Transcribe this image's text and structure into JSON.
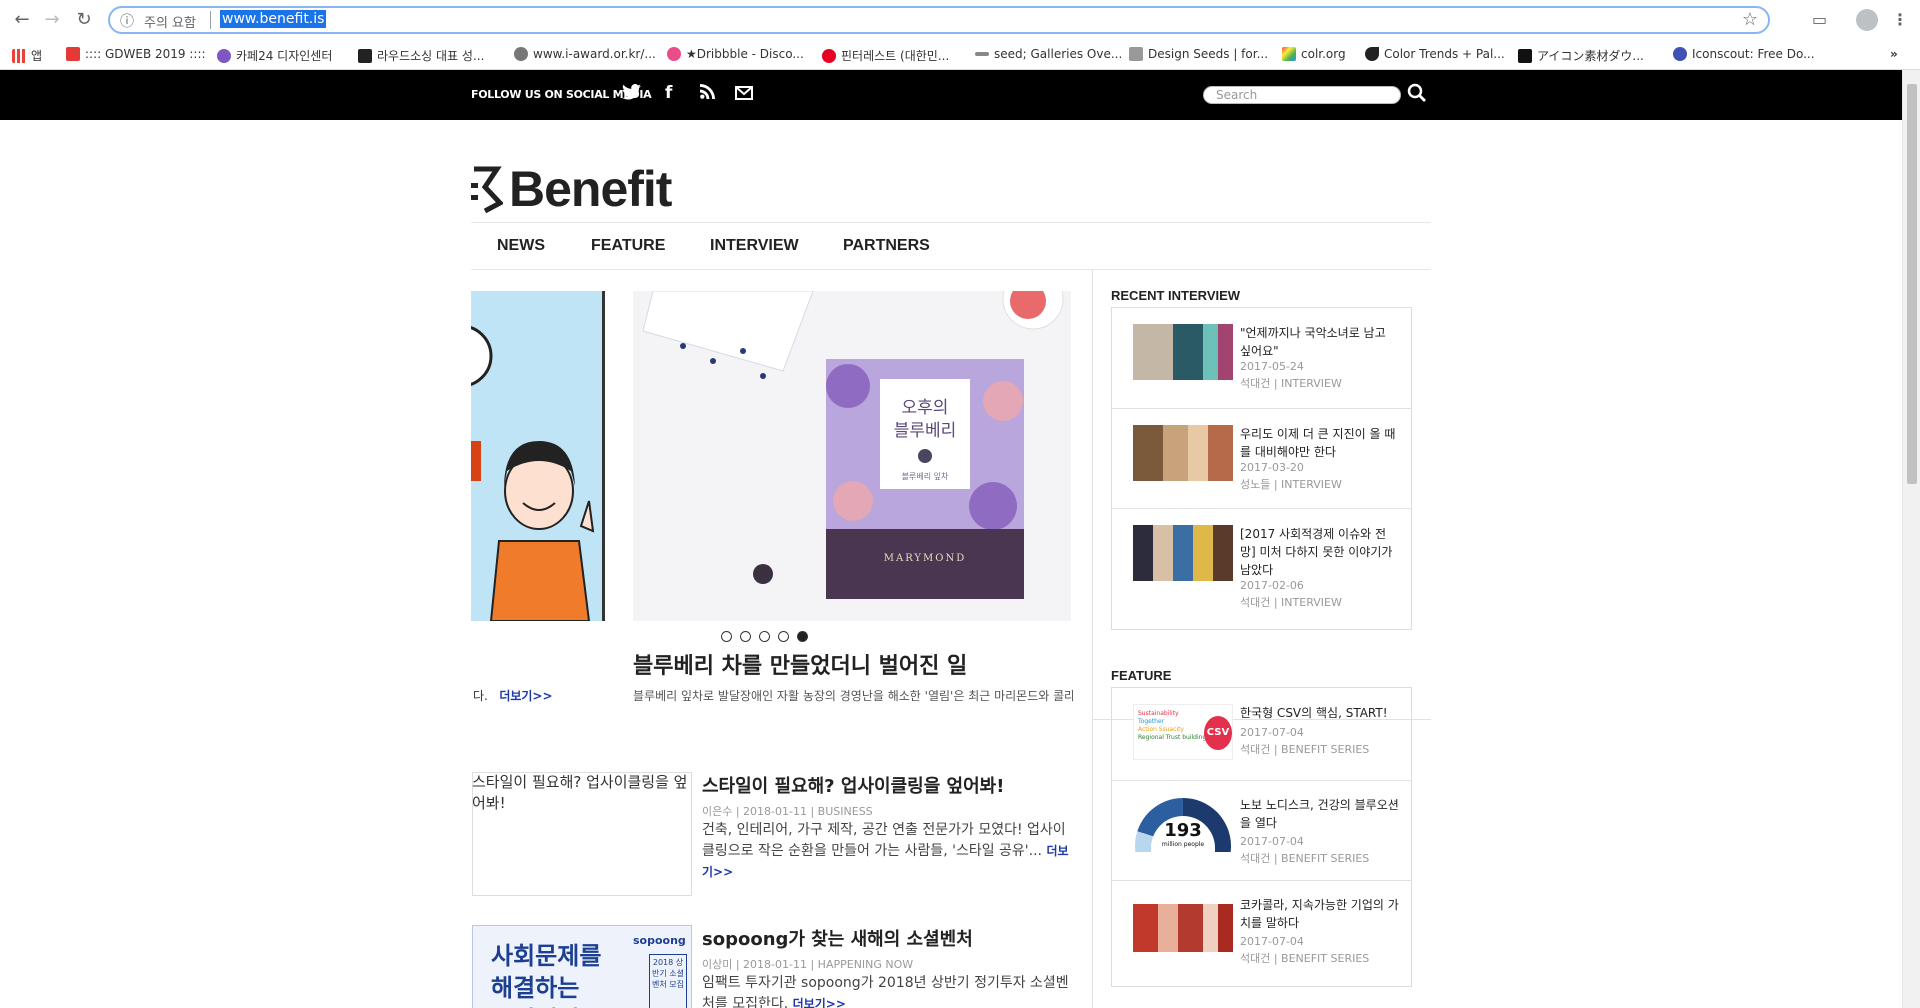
{
  "browser": {
    "security_label": "주의 요함",
    "url": "www.benefit.is",
    "bookmarks": [
      {
        "label": "앱",
        "color": "#ea4335"
      },
      {
        "label": ":::: GDWEB 2019 ::::",
        "color": "#e53935"
      },
      {
        "label": "카페24 디자인센터",
        "color": "#7e57c2"
      },
      {
        "label": "라우드소싱 대표 성...",
        "color": "#222222"
      },
      {
        "label": "www.i-award.or.kr/...",
        "color": "#555555"
      },
      {
        "label": "★Dribbble - Disco...",
        "color": "#ea4c89"
      },
      {
        "label": "핀터레스트 (대한민...",
        "color": "#e60023"
      },
      {
        "label": "seed; Galleries Ove...",
        "color": "#333333"
      },
      {
        "label": "Design Seeds | for...",
        "color": "#666666"
      },
      {
        "label": "colr.org",
        "color": "#43a047"
      },
      {
        "label": "Color Trends + Pal...",
        "color": "#222222"
      },
      {
        "label": "アイコン素材ダウ...",
        "color": "#111111"
      },
      {
        "label": "Iconscout: Free Do...",
        "color": "#3f51b5"
      }
    ]
  },
  "topbar": {
    "follow_label": "FOLLOW US ON SOCIAL MEDIA",
    "search_placeholder": "Search"
  },
  "logo": {
    "text": "Benefit"
  },
  "nav": {
    "items": [
      "NEWS",
      "FEATURE",
      "INTERVIEW",
      "PARTNERS"
    ]
  },
  "slider": {
    "product_line1": "오후의",
    "product_line2": "블루베리",
    "product_small": "블루베리 잎차",
    "brand": "MARYMOND",
    "dots": 5,
    "active_dot": 4,
    "title": "블루베리 차를 만들었더니 벌어진 일",
    "left_fragment": "다.",
    "more_label": "더보기>>",
    "summary": "블루베리 잎차로 발달장애인 자활 농장의 경영난을 해소한 '열림'은 최근 마리몬드와 콜라보"
  },
  "articles": [
    {
      "image_alt": "스타일이 필요해? 업사이클링을 엎어봐!",
      "title": "스타일이 필요해? 업사이클링을 엎어봐!",
      "meta": "이은수 | 2018-01-11 | BUSINESS",
      "summary": "건축, 인테리어, 가구 제작, 공간 연출 전문가가 모였다! 업사이클링으로 작은 순환을 만들어 가는 사람들, '스타일 공유'...",
      "more": "더보기>>"
    },
    {
      "image_big": "사회문제를\n해결하는\n소셜벤처",
      "image_tag": "sopoong",
      "image_box": "2018 상반기 소셜벤처 모집",
      "title": "sopoong가 찾는 새해의 소셜벤처",
      "meta": "이상미 | 2018-01-11 | HAPPENING NOW",
      "summary": "임팩트 투자기관 sopoong가 2018년 상반기 정기투자 소셜벤처를 모집한다.",
      "more": "더보기>>"
    }
  ],
  "sidebar": {
    "recent_interview": {
      "heading": "RECENT INTERVIEW",
      "items": [
        {
          "title": "\"언제까지나 국악소녀로 남고 싶어요\"",
          "date": "2017-05-24",
          "byline": "석대건 | INTERVIEW"
        },
        {
          "title": "우리도 이제 더 큰 지진이 올 때를 대비해야만 한다",
          "date": "2017-03-20",
          "byline": "성노들 | INTERVIEW"
        },
        {
          "title": "[2017 사회적경제 이슈와 전망] 미처 다하지 못한 이야기가 남았다",
          "date": "2017-02-06",
          "byline": "석대건 | INTERVIEW"
        }
      ]
    },
    "feature": {
      "heading": "FEATURE",
      "items": [
        {
          "title": "한국형 CSV의 핵심, START!",
          "date": "2017-07-04",
          "byline": "석대건 | BENEFIT SERIES",
          "thumb_words": [
            "Sustainability",
            "Together",
            "Action Ssuacity",
            "Regional Trust building"
          ],
          "thumb_badge": "CSV"
        },
        {
          "title": "노보 노디스크, 건강의 블루오션을 열다",
          "date": "2017-07-04",
          "byline": "석대건 | BENEFIT SERIES",
          "thumb_number": "193",
          "thumb_caption": "million people"
        },
        {
          "title": "코카콜라, 지속가능한 기업의 가치를 말하다",
          "date": "2017-07-04",
          "byline": "석대건 | BENEFIT SERIES"
        }
      ]
    }
  }
}
